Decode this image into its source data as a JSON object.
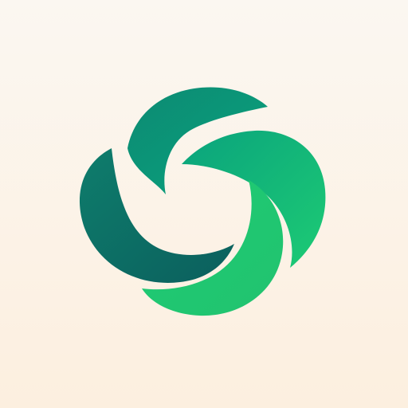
{
  "logo": {
    "icon": "pinwheel-logo-icon",
    "colors": {
      "background_top": "#FBF7F1",
      "background_bottom": "#FCEFDF",
      "petal_dark": "#0B5F5D",
      "petal_mid": "#0E8E73",
      "petal_bright": "#1DCB74",
      "petal_teal": "#0AA37D"
    }
  }
}
